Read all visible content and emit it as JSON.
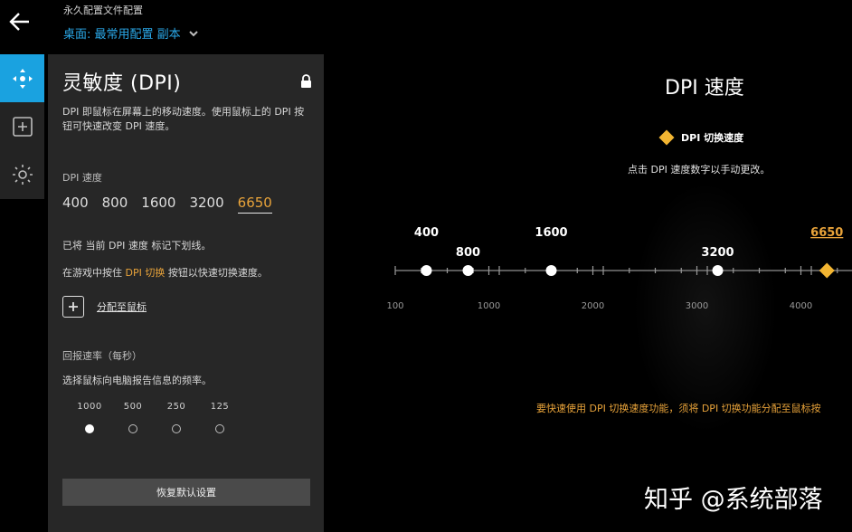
{
  "header": {
    "profile_label": "永久配置文件配置",
    "profile_name": "桌面: 最常用配置 副本"
  },
  "rail": {
    "items": [
      "sensitivity-icon",
      "add-icon",
      "lighting-icon"
    ],
    "accent": "#1aa2e0"
  },
  "panel": {
    "title": "灵敏度 (DPI)",
    "description": "DPI 即鼠标在屏幕上的移动速度。使用鼠标上的 DPI 按钮可快速改变 DPI 速度。",
    "dpi_label": "DPI 速度",
    "dpi_values": [
      "400",
      "800",
      "1600",
      "3200",
      "6650"
    ],
    "current_dpi_index": 4,
    "note1": "已将 当前 DPI 速度 标记下划线。",
    "note2_pre": "在游戏中按住 ",
    "note2_hl": "DPI 切换",
    "note2_post": " 按钮以快速切换速度。",
    "assign_label": "分配至鼠标",
    "rate_label": "回报速率（每秒）",
    "rate_desc": "选择鼠标向电脑报告信息的频率。",
    "rates": [
      "1000",
      "500",
      "250",
      "125"
    ],
    "selected_rate_index": 0,
    "reset_label": "恢复默认设置"
  },
  "right": {
    "title": "DPI 速度",
    "legend": "DPI 切换速度",
    "hint": "点击 DPI 速度数字以手动更改。",
    "warning": "要快速使用 DPI 切换速度功能，须将 DPI 切换功能分配至鼠标按",
    "watermark": "知乎 @系统部落"
  },
  "slider": {
    "points": [
      {
        "value": 400,
        "label": "400"
      },
      {
        "value": 800,
        "label": "800"
      },
      {
        "value": 1600,
        "label": "1600"
      },
      {
        "value": 3200,
        "label": "3200"
      },
      {
        "value": 4250,
        "label": "6650",
        "current": true
      }
    ],
    "axis_labels": [
      {
        "value": 100,
        "label": "100"
      },
      {
        "value": 1000,
        "label": "1000"
      },
      {
        "value": 2000,
        "label": "2000"
      },
      {
        "value": 3000,
        "label": "3000"
      },
      {
        "value": 4000,
        "label": "4000"
      }
    ],
    "accent": "#f2b532",
    "current_color": "#e8a33a"
  }
}
